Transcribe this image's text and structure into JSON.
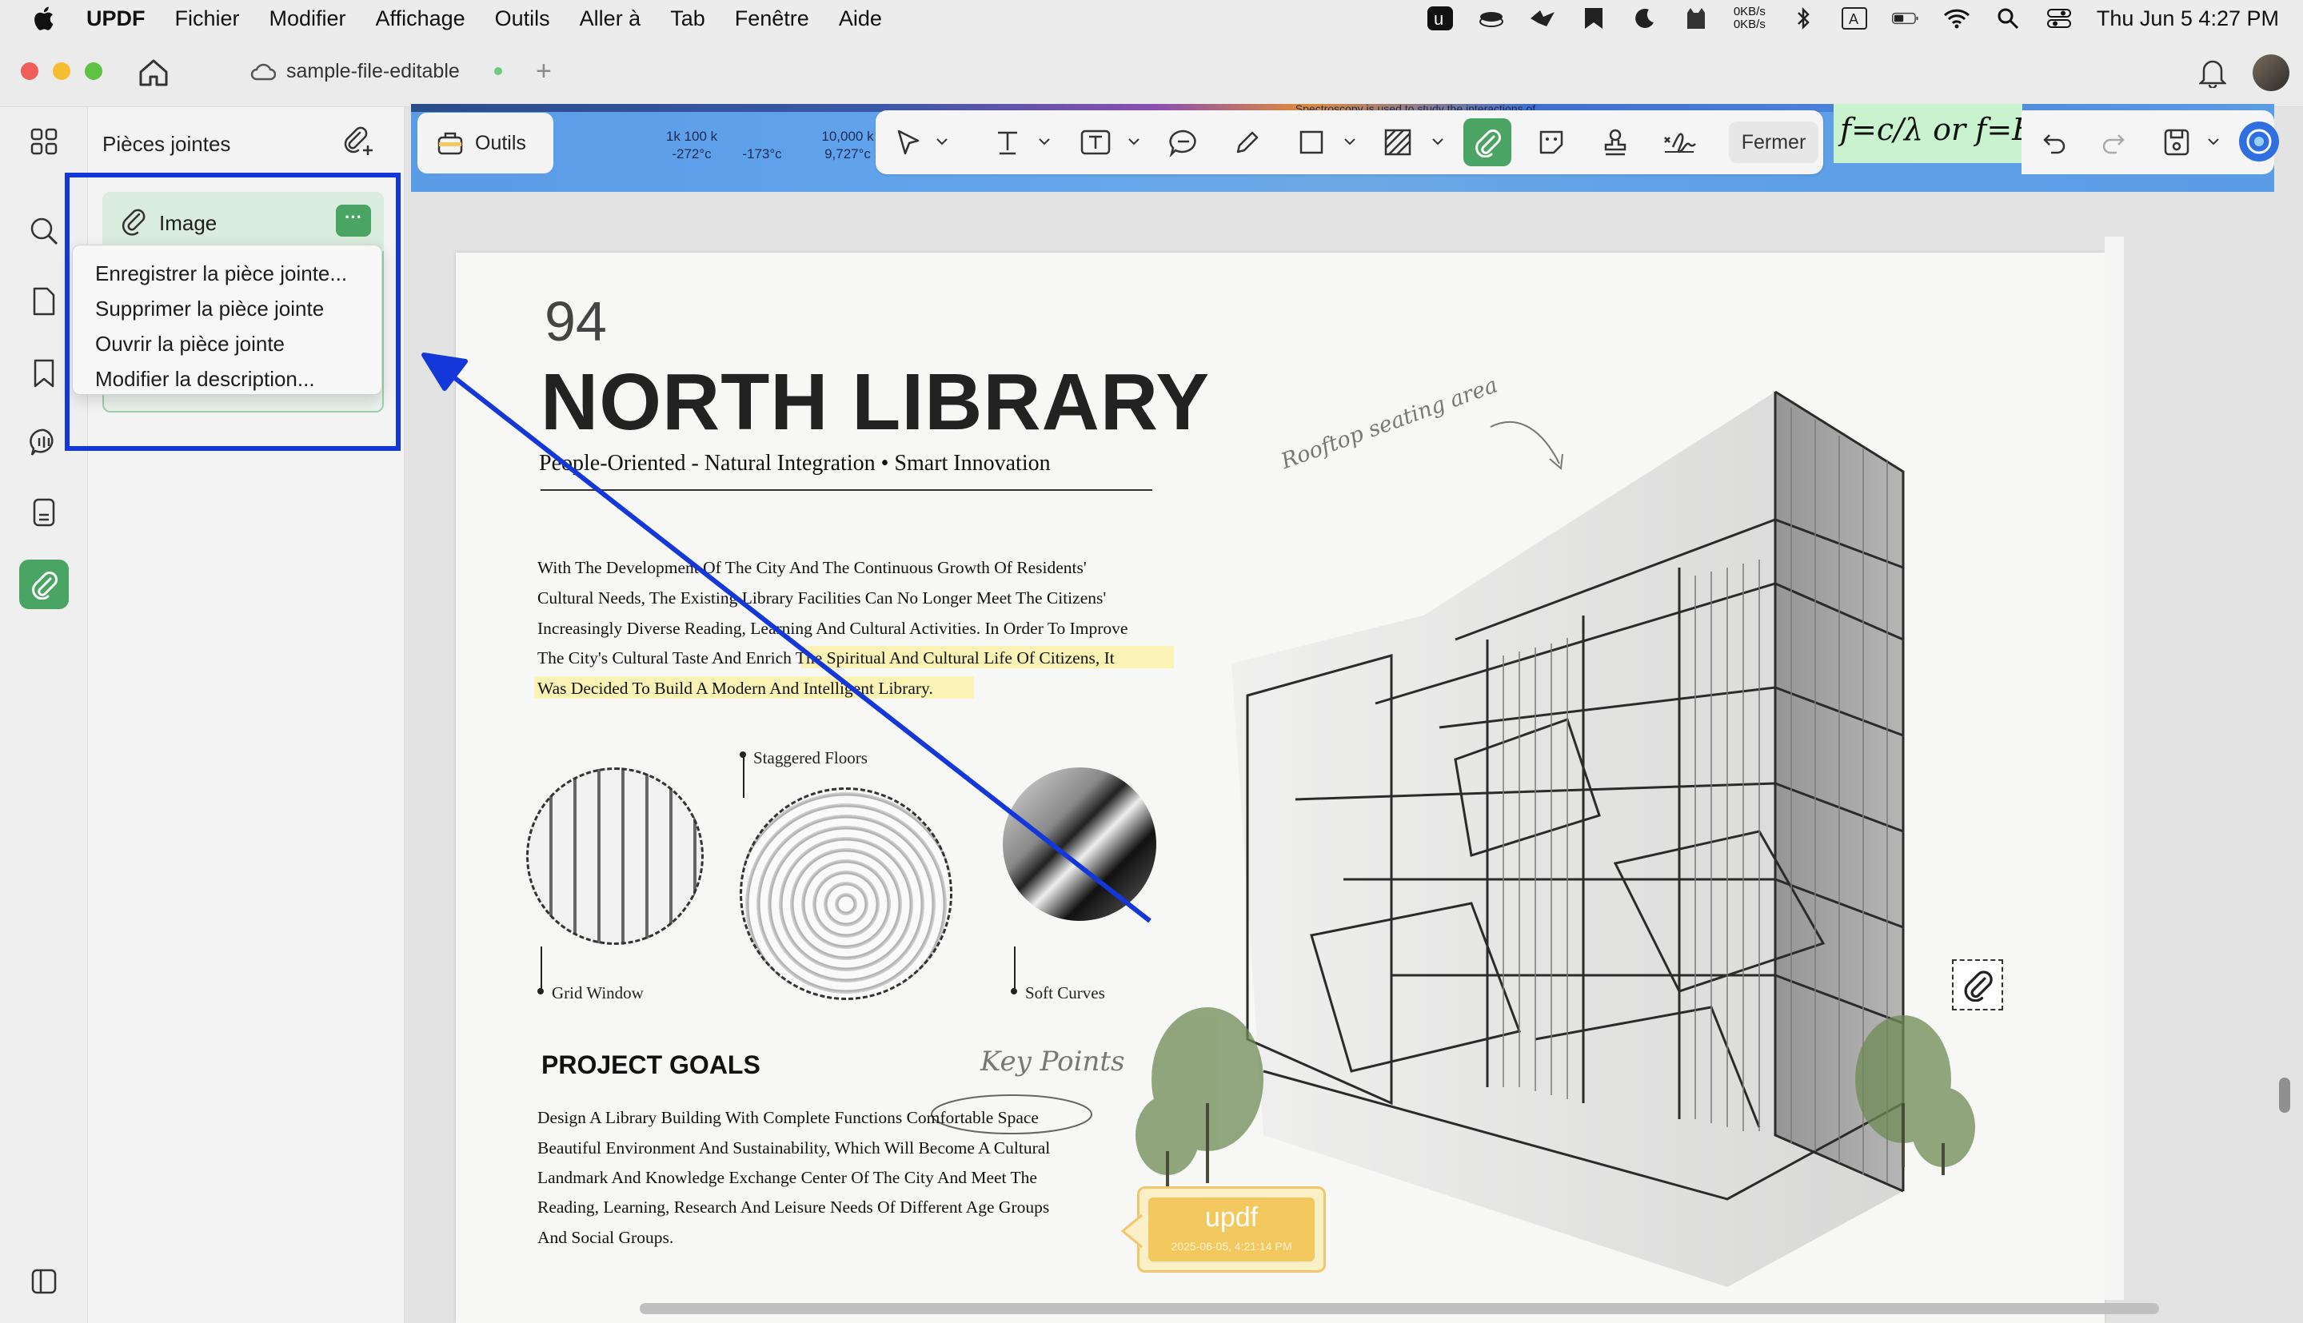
{
  "menubar": {
    "app_name": "UPDF",
    "items": [
      "Fichier",
      "Modifier",
      "Affichage",
      "Outils",
      "Aller à",
      "Tab",
      "Fenêtre",
      "Aide"
    ],
    "net_up": "0KB/s",
    "net_down": "0KB/s",
    "clock": "Thu Jun 5  4:27 PM"
  },
  "tab": {
    "title": "sample-file-editable"
  },
  "panel": {
    "title": "Pièces jointes",
    "attachment_name": "Image",
    "more_label": "···",
    "context_menu": [
      "Enregistrer la pièce jointe...",
      "Supprimer la pièce jointe",
      "Ouvrir la pièce jointe",
      "Modifier la description..."
    ]
  },
  "toolbar": {
    "tools_label": "Outils",
    "close_label": "Fermer",
    "strip": {
      "a": "1k 100 k",
      "a2": "-272°c",
      "b": "-173°c",
      "c": "10,000 k",
      "c2": "9,727°c",
      "top_text": "Spectroscopy is used to study the interactions of"
    },
    "formula": "f=c/λ or f=E/h"
  },
  "page": {
    "number": "94",
    "title": "NORTH LIBRARY",
    "subtitle": "People-Oriented - Natural Integration • Smart Innovation",
    "intro_lines": [
      "With The Development Of The City And The Continuous Growth Of Residents'",
      "Cultural Needs, The Existing Library Facilities Can No Longer Meet The Citizens'",
      "Increasingly Diverse Reading, Learning And Cultural Activities. In Order To Improve",
      "The City's Cultural Taste And Enrich The Spiritual And Cultural Life Of Citizens, It",
      "Was Decided To Build A Modern And Intelligent Library."
    ],
    "captions": {
      "staggered": "Staggered Floors",
      "grid": "Grid Window",
      "soft": "Soft Curves"
    },
    "rooftop": "Rooftop seating area",
    "goals_title": "PROJECT GOALS",
    "key_points": "Key Points",
    "goals_lines": [
      "Design A Library Building With Complete Functions Comfortable Space",
      "Beautiful Environment And Sustainability, Which Will Become A Cultural",
      "Landmark And Knowledge Exchange Center Of The City And Meet The",
      "Reading, Learning, Research And Leisure Needs Of Different Age Groups",
      "And Social Groups."
    ],
    "stamp_title": "updf",
    "stamp_date": "2025-06-05, 4:21:14 PM"
  },
  "colors": {
    "accent_green": "#4aa564",
    "annotation_blue": "#1437d9",
    "highlight_yellow": "#fbf3b5"
  }
}
